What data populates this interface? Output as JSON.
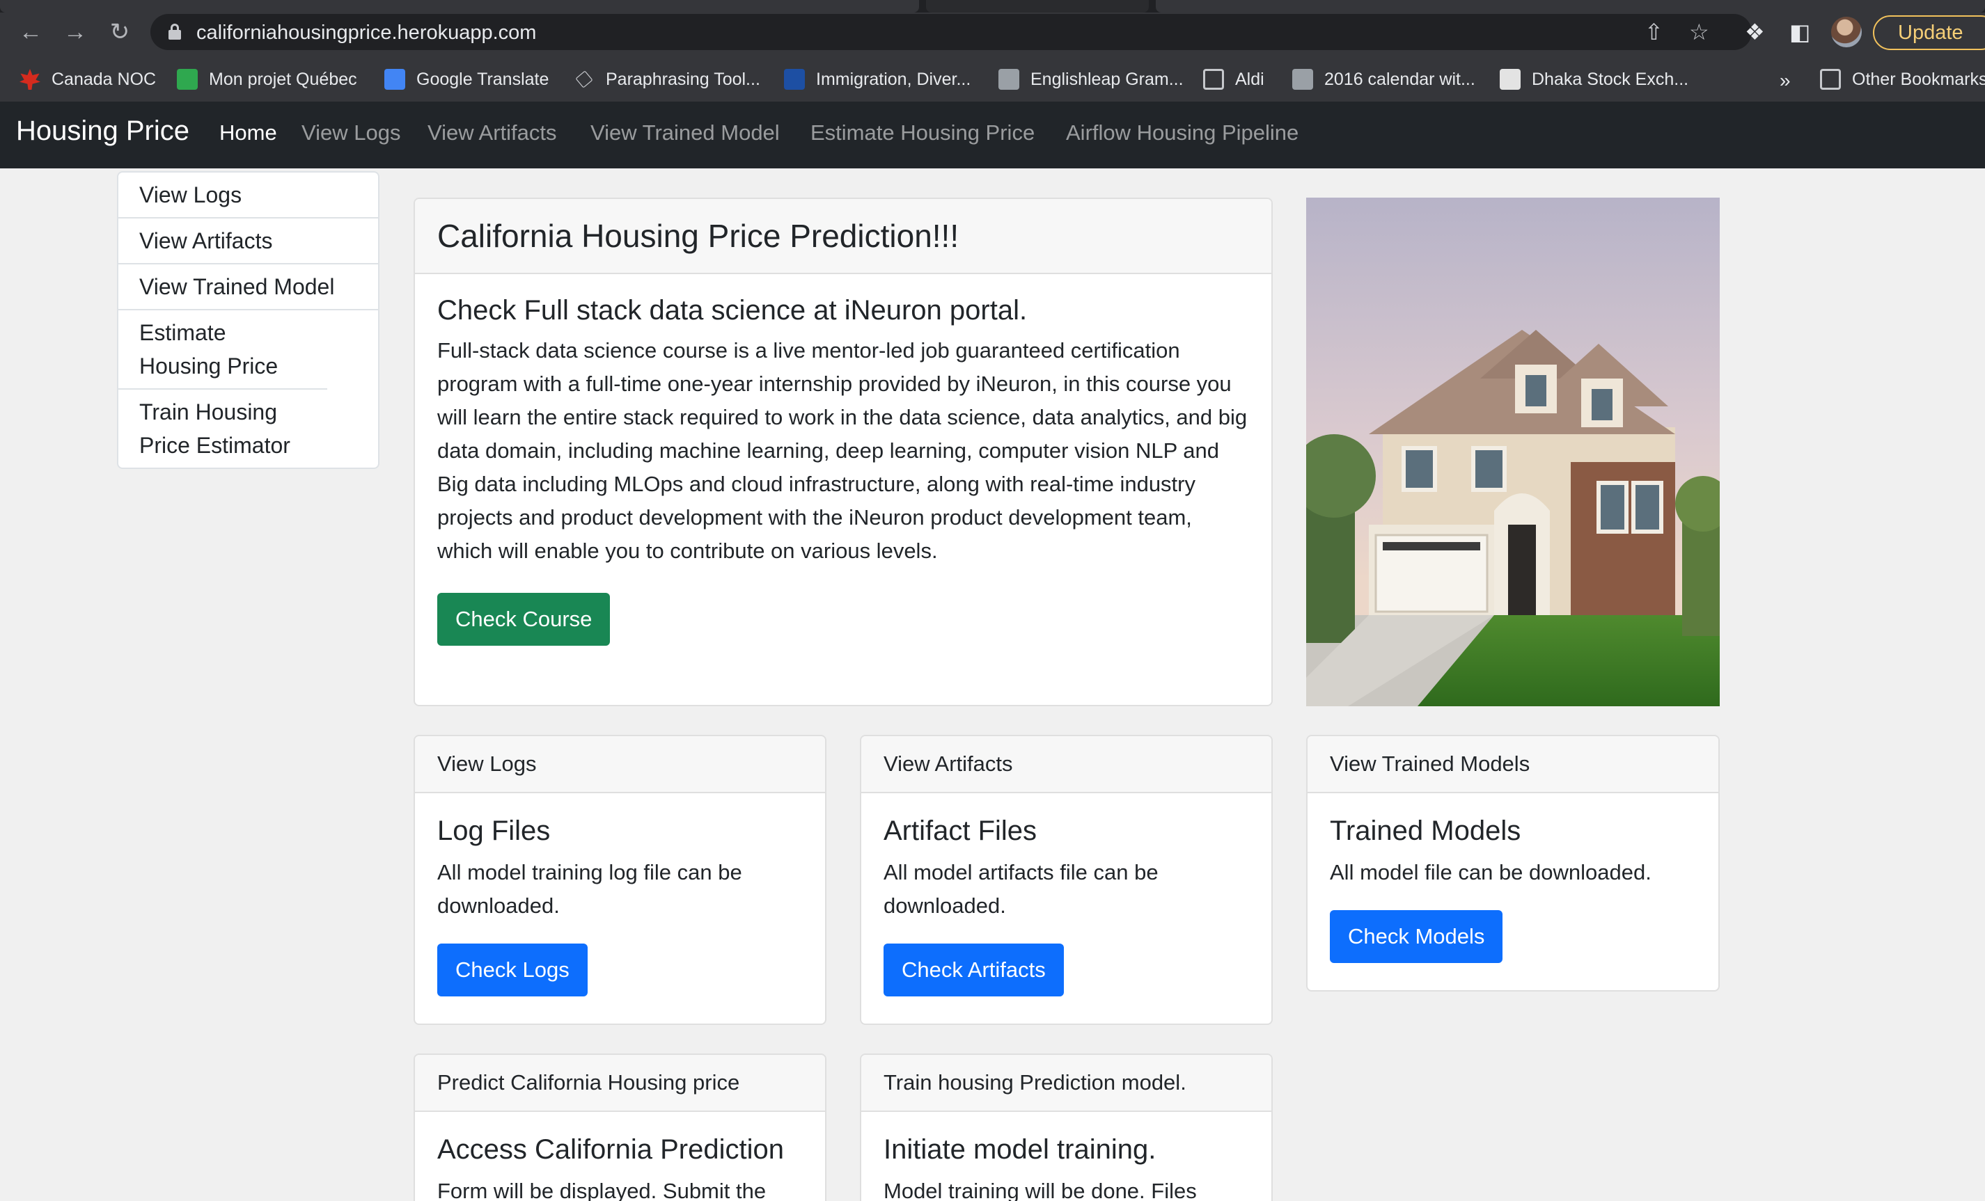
{
  "browser": {
    "url": "californiahousingprice.herokuapp.com",
    "update_label": "Update",
    "bookmarks": [
      {
        "label": "Canada NOC",
        "icon": "maple-leaf-icon"
      },
      {
        "label": "Mon projet Québec",
        "icon": "green-board-icon"
      },
      {
        "label": "Google Translate",
        "icon": "google-translate-icon"
      },
      {
        "label": "Paraphrasing Tool...",
        "icon": "pen-icon"
      },
      {
        "label": "Immigration, Diver...",
        "icon": "quebec-flag-icon"
      },
      {
        "label": "Englishleap Gram...",
        "icon": "globe-icon"
      },
      {
        "label": "Aldi",
        "icon": "folder-icon"
      },
      {
        "label": "2016 calendar wit...",
        "icon": "globe-icon"
      },
      {
        "label": "Dhaka Stock Exch...",
        "icon": "dse-icon"
      }
    ],
    "more_bookmarks": "»",
    "other_bookmarks": "Other Bookmarks"
  },
  "navbar": {
    "brand": "Housing Price",
    "links": [
      "Home",
      "View Logs",
      "View Artifacts",
      "View Trained Model",
      "Estimate Housing Price",
      "Airflow Housing Pipeline"
    ]
  },
  "sidebar": {
    "items": [
      "View Logs",
      "View Artifacts",
      "View Trained Model",
      "Estimate Housing Price",
      "Train Housing Price Estimator"
    ]
  },
  "hero": {
    "header": "California Housing Price Prediction!!!",
    "title": "Check Full stack data science at iNeuron portal.",
    "text": "Full-stack data science course is a live mentor-led job guaranteed certification program with a full-time one-year internship provided by iNeuron, in this course you will learn the entire stack required to work in the data science, data analytics, and big data domain, including machine learning, deep learning, computer vision NLP and Big data including MLOps and cloud infrastructure, along with real-time industry projects and product development with the iNeuron product development team, which will enable you to contribute on various levels.",
    "button": "Check Course"
  },
  "cards": {
    "logs": {
      "header": "View Logs",
      "title": "Log Files",
      "text": "All model training log file can be downloaded.",
      "button": "Check Logs"
    },
    "artifacts": {
      "header": "View Artifacts",
      "title": "Artifact Files",
      "text": "All model artifacts file can be downloaded.",
      "button": "Check Artifacts"
    },
    "models": {
      "header": "View Trained Models",
      "title": "Trained Models",
      "text": "All model file can be downloaded.",
      "button": "Check Models"
    },
    "predict": {
      "header": "Predict California Housing price",
      "title": "Access California Prediction",
      "text": "Form will be displayed. Submit the"
    },
    "train": {
      "header": "Train housing Prediction model.",
      "title": "Initiate model training.",
      "text": "Model training will be done. Files"
    }
  },
  "colors": {
    "navbar_bg": "#212529",
    "primary_button": "#0d6efd",
    "success_button": "#198754",
    "page_bg": "#f0f0f0"
  }
}
